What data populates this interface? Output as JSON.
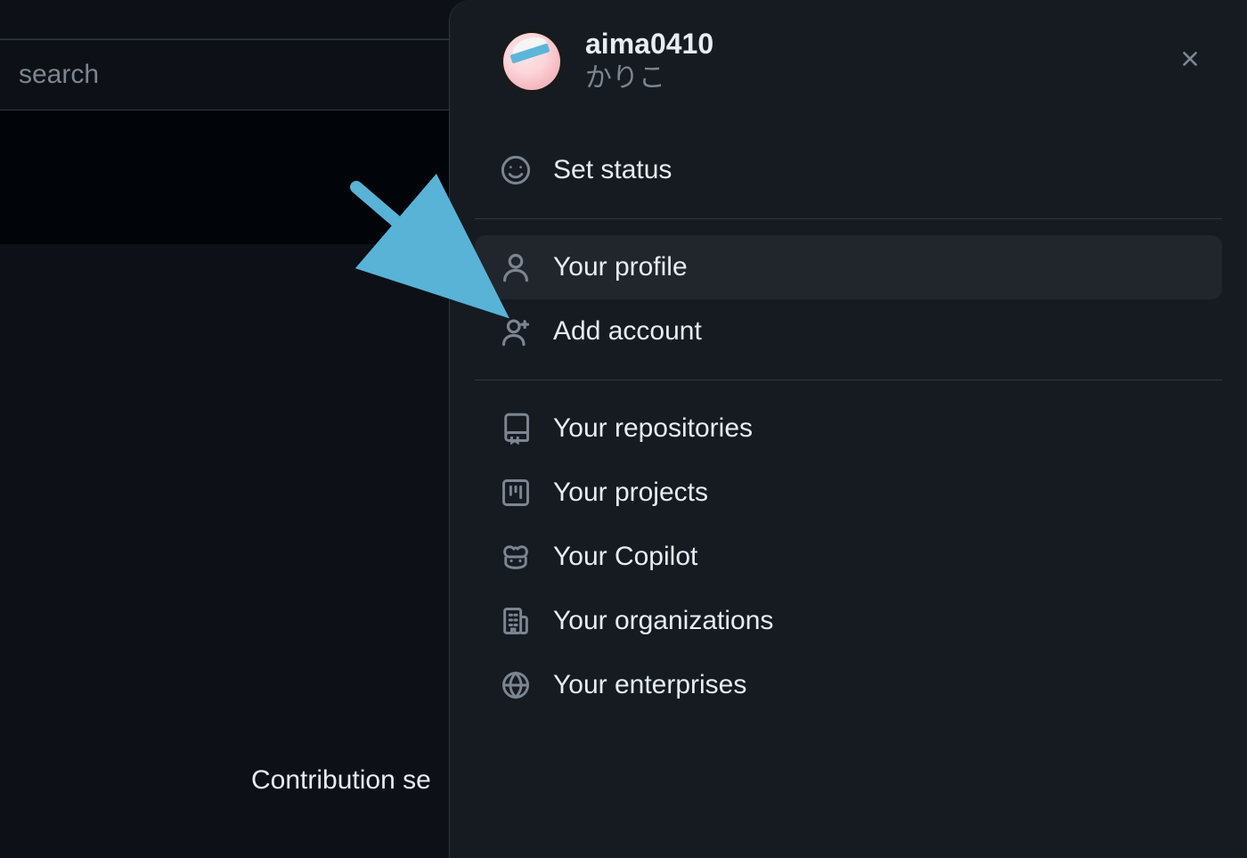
{
  "background": {
    "search_placeholder": "search",
    "contribution_text": "Contribution se"
  },
  "user": {
    "username": "aima0410",
    "display_name": "かりこ"
  },
  "menu": {
    "section1": {
      "set_status": "Set status"
    },
    "section2": {
      "your_profile": "Your profile",
      "add_account": "Add account"
    },
    "section3": {
      "your_repositories": "Your repositories",
      "your_projects": "Your projects",
      "your_copilot": "Your Copilot",
      "your_organizations": "Your organizations",
      "your_enterprises": "Your enterprises"
    }
  }
}
